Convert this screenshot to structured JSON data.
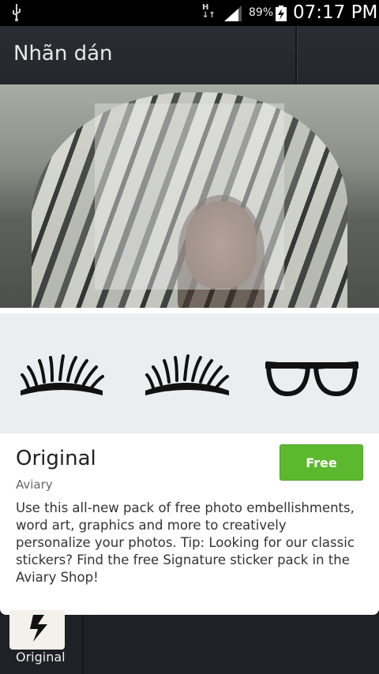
{
  "status_bar": {
    "network_type": "H",
    "battery_percent": "89%",
    "time": "07:17 PM",
    "icons": [
      "usb-icon",
      "data-arrows-icon",
      "signal-icon",
      "battery-charging-icon"
    ]
  },
  "action_bar": {
    "title": "Nhãn dán"
  },
  "pack": {
    "name": "Original",
    "author": "Aviary",
    "price_label": "Free",
    "description": "Use this all-new pack of free photo embellishments, word art, graphics and more to creatively personalize your photos. Tip: Looking for our classic stickers? Find the free Signature sticker pack in the Aviary Shop!",
    "preview_stickers": [
      "eyelashes-left-sticker",
      "eyelashes-right-sticker",
      "glasses-sticker"
    ],
    "accent_color": "#5cb82e"
  },
  "bottom_tray": {
    "items": [
      {
        "label": "Original",
        "icon": "sticker-pack-thumbnail"
      }
    ]
  }
}
